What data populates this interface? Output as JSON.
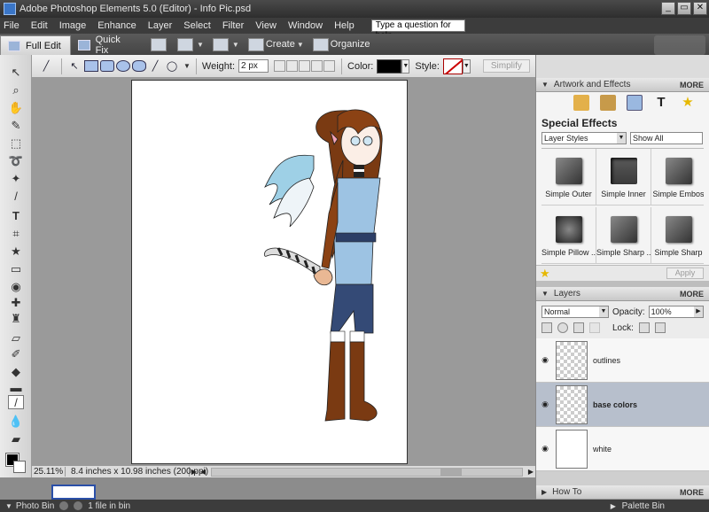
{
  "window": {
    "title": "Adobe Photoshop Elements 5.0 (Editor) - Info Pic.psd",
    "controls": [
      "_",
      "▭",
      "✕"
    ]
  },
  "menu": {
    "items": [
      "File",
      "Edit",
      "Image",
      "Enhance",
      "Layer",
      "Select",
      "Filter",
      "View",
      "Window",
      "Help"
    ],
    "help_placeholder": "Type a question for help"
  },
  "shortcuts": {
    "full_edit": "Full Edit",
    "quick_fix": "Quick Fix",
    "create": "Create",
    "organize": "Organize"
  },
  "options": {
    "weight_label": "Weight:",
    "weight_value": "2 px",
    "color_label": "Color:",
    "color_value": "#000000",
    "style_label": "Style:",
    "simplify": "Simplify"
  },
  "toolbox": {
    "tools": [
      "move-tool",
      "zoom-tool",
      "hand-tool",
      "eyedropper-tool",
      "marquee-tool",
      "lasso-tool",
      "magic-wand-tool",
      "selection-brush-tool",
      "type-tool",
      "crop-tool",
      "cookie-cutter-tool",
      "straighten-tool",
      "red-eye-tool",
      "healing-brush-tool",
      "clone-stamp-tool",
      "eraser-tool",
      "brush-tool",
      "paint-bucket-tool",
      "gradient-tool",
      "shape-tool",
      "blur-tool",
      "sponge-tool"
    ]
  },
  "status": {
    "zoom": "25.11%",
    "doc_info": "8.4 inches x 10.98 inches (200 ppi)"
  },
  "artwork_panel": {
    "title": "Artwork and Effects",
    "more": "MORE",
    "section_title": "Special Effects",
    "filter_select": "Layer Styles",
    "show_select": "Show All",
    "effects": [
      "Simple Outer",
      "Simple Inner",
      "Simple Embos",
      "Simple Pillow ...",
      "Simple Sharp ...",
      "Simple Sharp"
    ],
    "apply": "Apply"
  },
  "layers_panel": {
    "title": "Layers",
    "more": "MORE",
    "blend_mode": "Normal",
    "opacity_label": "Opacity:",
    "opacity_value": "100%",
    "lock_label": "Lock:",
    "layers": [
      {
        "name": "outlines",
        "visible": true,
        "selected": false
      },
      {
        "name": "base colors",
        "visible": true,
        "selected": true
      },
      {
        "name": "white",
        "visible": true,
        "selected": false
      }
    ]
  },
  "howto_panel": {
    "title": "How To",
    "more": "MORE"
  },
  "bottom": {
    "photo_bin": "Photo Bin",
    "bin_count": "1 file in bin",
    "palette_bin": "Palette Bin"
  }
}
